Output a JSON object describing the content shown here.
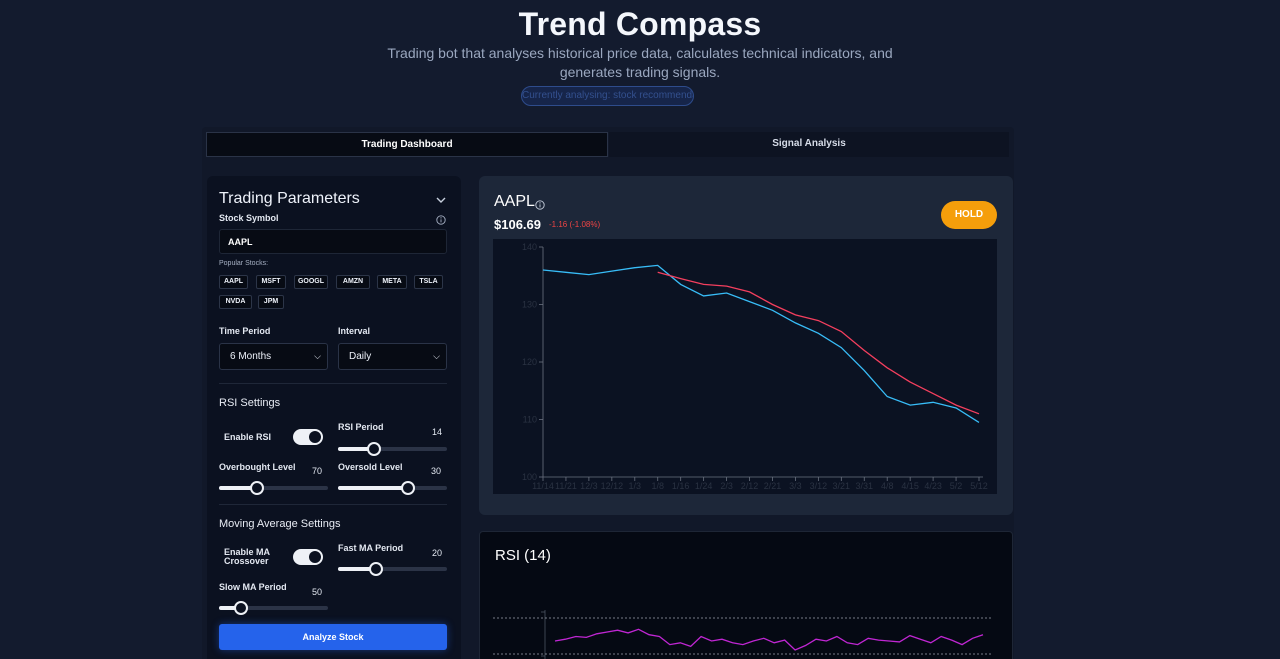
{
  "header": {
    "title": "Trend Compass",
    "subtitle": "Trading bot that analyses historical price data, calculates technical indicators, and generates trading signals.",
    "credit": "Currently analysing: stock recommendations"
  },
  "tabs": [
    {
      "label": "Trading Dashboard",
      "active": true
    },
    {
      "label": "Signal Analysis",
      "active": false
    }
  ],
  "sidebar": {
    "title": "Trading Parameters",
    "stock_symbol_label": "Stock Symbol",
    "symbol_value": "AAPL",
    "popular_label": "Popular Stocks:",
    "popular": [
      "AAPL",
      "MSFT",
      "GOOGL",
      "AMZN",
      "META",
      "TSLA",
      "NVDA",
      "JPM"
    ],
    "time_period_label": "Time Period",
    "time_period_value": "6 Months",
    "interval_label": "Interval",
    "interval_value": "Daily",
    "rsi_settings_title": "RSI Settings",
    "enable_rsi_label": "Enable RSI",
    "rsi_period_label": "RSI Period",
    "rsi_period_value": "14",
    "overbought_label": "Overbought Level",
    "overbought_value": "70",
    "oversold_label": "Oversold Level",
    "oversold_value": "30",
    "ma_settings_title": "Moving Average Settings",
    "enable_ma_label": "Enable MA Crossover",
    "fast_ma_label": "Fast MA Period",
    "fast_ma_value": "20",
    "slow_ma_label": "Slow MA Period",
    "slow_ma_value": "50",
    "analyze_label": "Analyze Stock",
    "sliders": {
      "rsi_period_pct": 0.33,
      "overbought_pct": 0.35,
      "oversold_pct": 0.64,
      "fast_ma_pct": 0.35,
      "slow_ma_pct": 0.2
    }
  },
  "price_card": {
    "symbol": "AAPL",
    "price": "$106.69",
    "change": "-1.16 (-1.08%)",
    "signal": "HOLD"
  },
  "rsi_card": {
    "title": "RSI (14)"
  },
  "colors": {
    "accent": "#2563eb",
    "hold": "#f59e0b",
    "price_line": "#38bdf8",
    "ma_line": "#f43f5e",
    "rsi_line": "#c026d3",
    "negative": "#ef4444"
  },
  "chart_data": [
    {
      "type": "line",
      "x": [
        "11/14",
        "11/21",
        "12/3",
        "12/12",
        "1/3",
        "1/8",
        "1/16",
        "1/24",
        "2/3",
        "2/12",
        "2/21",
        "3/3",
        "3/12",
        "3/21",
        "3/31",
        "4/8",
        "4/15",
        "4/23",
        "5/2",
        "5/12"
      ],
      "yticks": [
        "100",
        "110",
        "120",
        "130",
        "140"
      ],
      "ylim": [
        100,
        140
      ],
      "series": [
        {
          "values": [
            136,
            135.6,
            135.2,
            135.8,
            136.4,
            136.8,
            133.5,
            131.5,
            132,
            130.5,
            129,
            126.8,
            125,
            122.5,
            118.5,
            114,
            112.5,
            113,
            112,
            109.5
          ]
        },
        {
          "values": [
            null,
            null,
            null,
            null,
            null,
            135.6,
            134.5,
            133.5,
            133.2,
            132.2,
            130,
            128.2,
            127.2,
            125.3,
            122,
            119,
            116.5,
            114.5,
            112.5,
            111
          ]
        }
      ]
    },
    {
      "type": "line",
      "title": "RSI (14)",
      "ylim": [
        0,
        100
      ],
      "reference_lines": [
        70,
        30
      ],
      "series": [
        {
          "values": [
            50,
            52,
            55,
            54,
            58,
            60,
            62,
            59,
            63,
            57,
            55,
            46,
            48,
            44,
            55,
            50,
            52,
            48,
            46,
            50,
            53,
            48,
            51,
            40,
            45,
            52,
            50,
            55,
            48,
            46,
            53,
            51,
            50,
            49,
            56,
            52,
            48,
            55,
            51,
            46,
            53,
            57
          ]
        }
      ]
    }
  ]
}
